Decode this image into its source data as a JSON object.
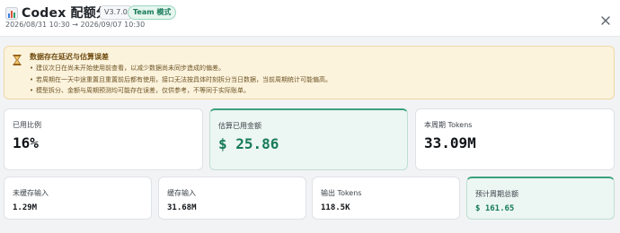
{
  "header": {
    "title": "Codex 配额分析",
    "version": "V3.7.0",
    "mode_badge": "Team 模式",
    "date_range": "2026/08/31 10:30 → 2026/09/07 10:30",
    "icon": "bar-chart-icon",
    "close_icon": "close-icon"
  },
  "warning": {
    "icon": "hourglass-icon",
    "title": "数据存在延迟与估算误差",
    "items": [
      "建议次日在尚未开始使用前查看，以减少数据尚未同步造成的偏差。",
      "若周期在一天中途重置且重置前后都有使用，接口无法按具体时刻拆分当日数据，当前周期统计可能偏高。",
      "模型拆分、金额与周期预测均可能存在误差，仅供参考，不等同于实际账单。"
    ]
  },
  "stats_top": [
    {
      "label": "已用比例",
      "value": "16%",
      "highlight": false
    },
    {
      "label": "估算已用金额",
      "value": "$ 25.86",
      "highlight": true
    },
    {
      "label": "本周期 Tokens",
      "value": "33.09M",
      "highlight": false
    }
  ],
  "stats_bottom": [
    {
      "label": "未缓存输入",
      "value": "1.29M",
      "highlight": false
    },
    {
      "label": "缓存输入",
      "value": "31.68M",
      "highlight": false
    },
    {
      "label": "输出 Tokens",
      "value": "118.5K",
      "highlight": false
    },
    {
      "label": "预计周期总额",
      "value": "$ 161.65",
      "highlight": true
    }
  ],
  "colors": {
    "accent": "#167a5a",
    "warning_bg": "#fcf3dd"
  }
}
